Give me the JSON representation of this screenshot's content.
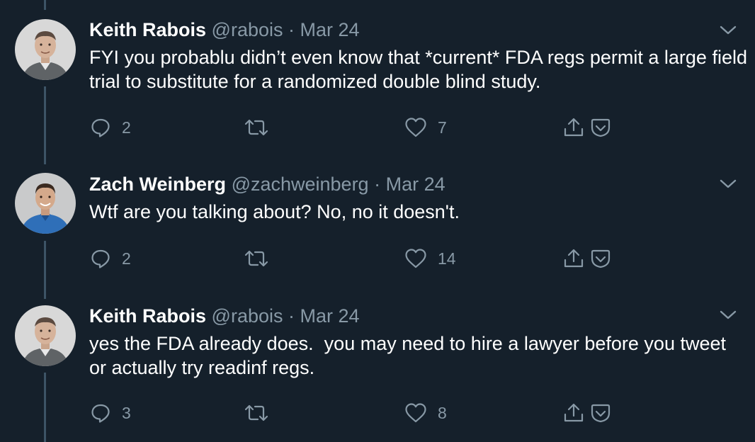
{
  "tweets": [
    {
      "name": "Keith Rabois",
      "handle": "@rabois",
      "separator": "·",
      "date": "Mar 24",
      "text": "FYI you probablu didn’t even know that *current* FDA regs permit a large field trial to substitute for a randomized double blind study.",
      "replies": "2",
      "retweets": "",
      "likes": "7"
    },
    {
      "name": "Zach Weinberg",
      "handle": "@zachweinberg",
      "separator": "·",
      "date": "Mar 24",
      "text": "Wtf are you talking about? No, no it doesn't.",
      "replies": "2",
      "retweets": "",
      "likes": "14"
    },
    {
      "name": "Keith Rabois",
      "handle": "@rabois",
      "separator": "·",
      "date": "Mar 24",
      "text": "yes the FDA already does.  you may need to hire a lawyer before you tweet or actually try readinf regs.",
      "replies": "3",
      "retweets": "",
      "likes": "8"
    }
  ],
  "colors": {
    "background": "#15202b",
    "secondary_text": "#8899a6",
    "thread_line": "#3d5466",
    "primary_text": "#ffffff"
  },
  "icons": [
    "reply-icon",
    "retweet-icon",
    "like-icon",
    "share-icon",
    "bookmark-icon",
    "chevron-down-icon"
  ]
}
